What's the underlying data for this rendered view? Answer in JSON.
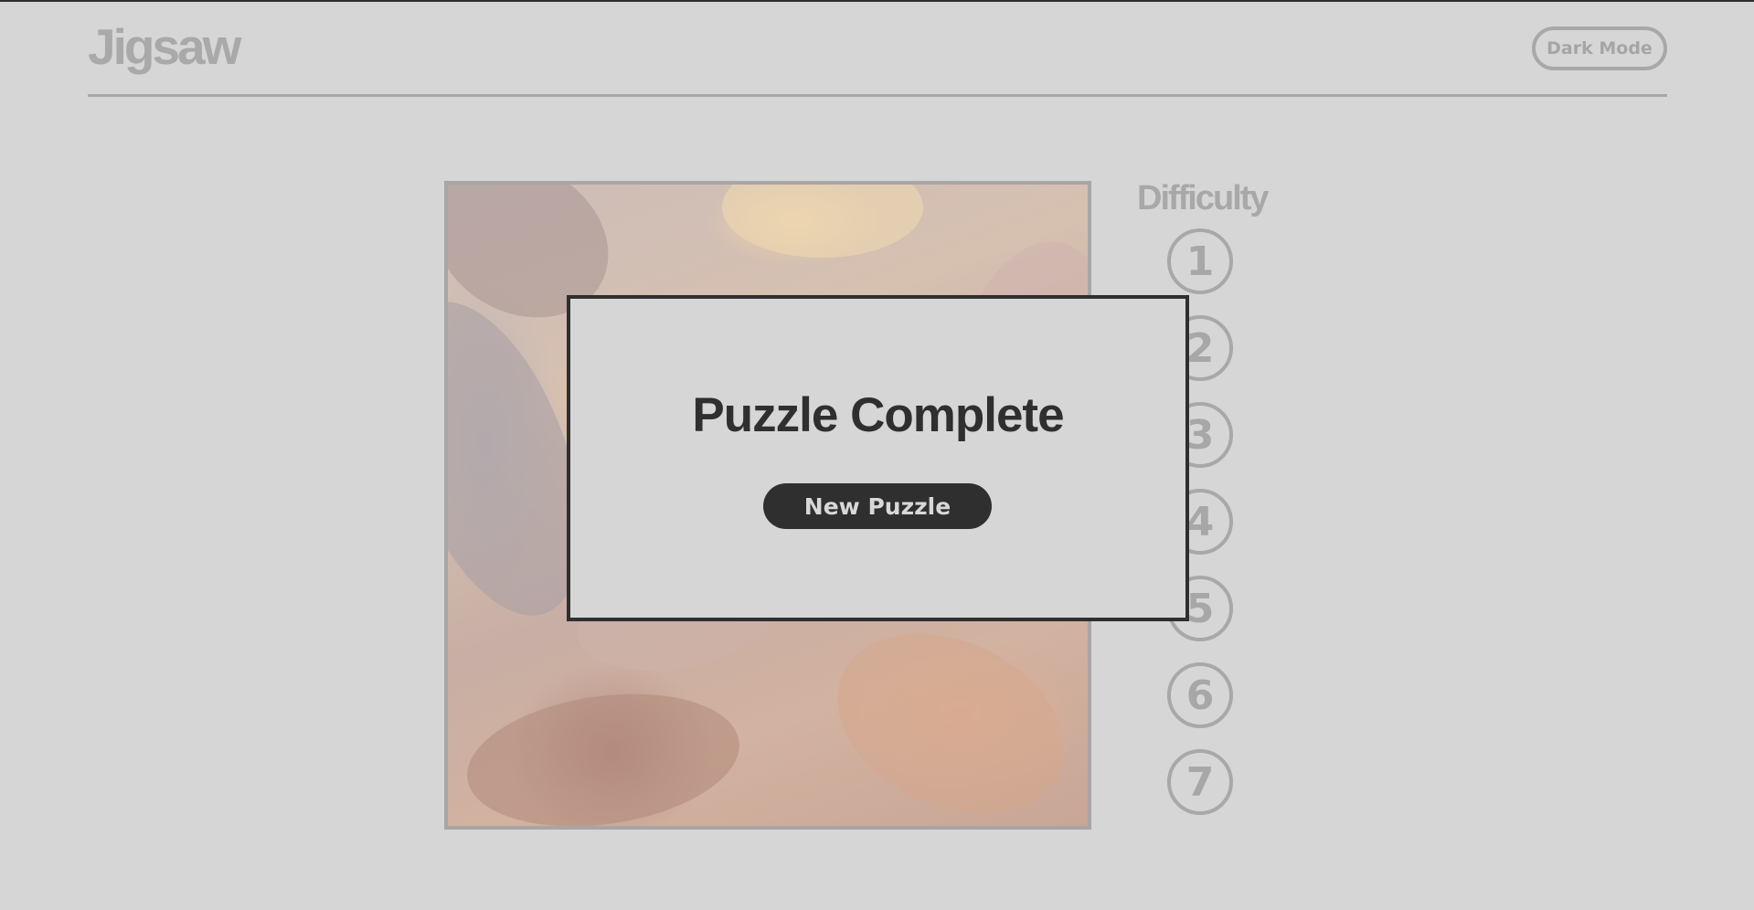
{
  "header": {
    "title": "Jigsaw",
    "dark_mode_label": "Dark Mode"
  },
  "difficulty": {
    "label": "Difficulty",
    "levels": [
      "1",
      "2",
      "3",
      "4",
      "5",
      "6",
      "7"
    ]
  },
  "modal": {
    "title": "Puzzle Complete",
    "button_label": "New Puzzle"
  },
  "colors": {
    "background": "#d6d6d6",
    "muted": "#a8a8a8",
    "dark": "#2f2f2f"
  }
}
